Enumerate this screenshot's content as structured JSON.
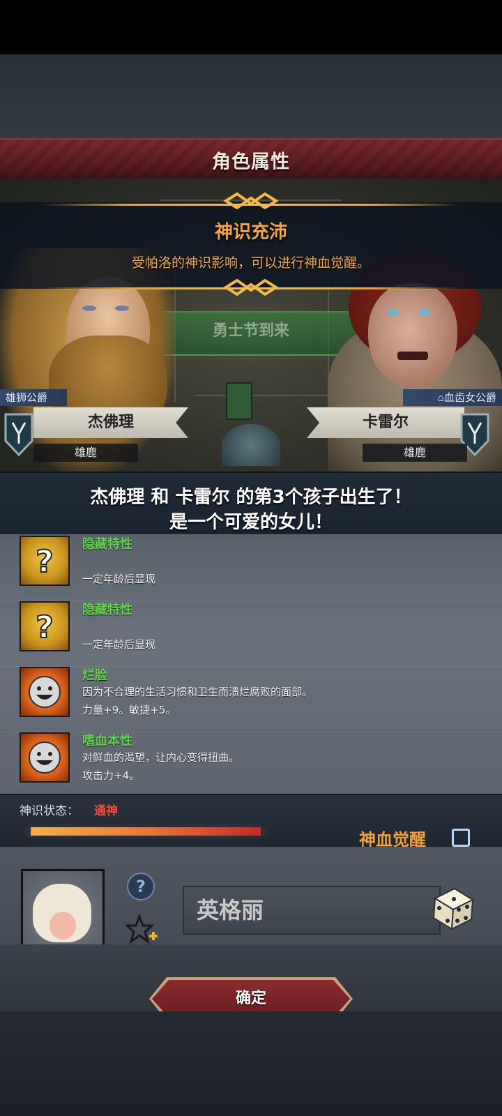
{
  "header": {
    "title": "角色属性"
  },
  "scene": {
    "map_banner_text": "勇士节到来"
  },
  "notice": {
    "title": "神识充沛",
    "description": "受帕洛的神识影响，可以进行神血觉醒。"
  },
  "parents": {
    "left": {
      "title": "雄狮公爵",
      "name": "杰佛理",
      "house": "雄鹿"
    },
    "right": {
      "title": "血齿女公爵",
      "name": "卡雷尔",
      "house": "雄鹿"
    }
  },
  "announcement": {
    "line1": "杰佛理 和 卡雷尔 的第3个孩子出生了！",
    "line2": "是一个可爱的女儿！"
  },
  "traits": [
    {
      "name": "隐藏特性",
      "desc1": "一定年龄后显现",
      "desc2": "",
      "icon": "question-mark-icon"
    },
    {
      "name": "隐藏特性",
      "desc1": "一定年龄后显现",
      "desc2": "",
      "icon": "question-mark-icon"
    },
    {
      "name": "烂脸",
      "desc1": "因为不合理的生活习惯和卫生而溃烂腐败的面部。",
      "desc2": "力量+9。敏捷+5。",
      "icon": "smiley-sun-icon"
    },
    {
      "name": "嗜血本性",
      "desc1": "对鲜血的渴望，让内心变得扭曲。",
      "desc2": "攻击力+4。",
      "icon": "smiley-sun-icon"
    }
  ],
  "divine": {
    "label": "神识状态：",
    "value": "通神",
    "bar_fraction": 1.0,
    "awaken_label": "神血觉醒",
    "awaken_checked": false
  },
  "child": {
    "name": "英格丽"
  },
  "confirm_label": "确定",
  "colors": {
    "accent_gold": "#f4a83c",
    "trait_green": "#5ed24a",
    "status_red": "#f04a3a",
    "banner_red": "#7a2a2e"
  }
}
